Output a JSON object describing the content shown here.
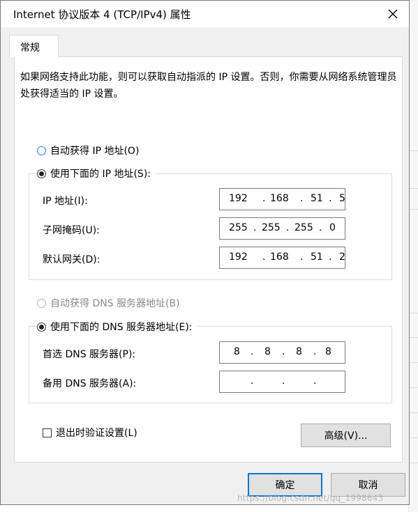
{
  "window": {
    "title": "Internet 协议版本 4 (TCP/IPv4) 属性"
  },
  "tabs": [
    {
      "label": "常规"
    }
  ],
  "description": "如果网络支持此功能，则可以获取自动指派的 IP 设置。否则，你需要从网络系统管理员处获得适当的 IP 设置。",
  "ip_options": {
    "auto": "自动获得 IP 地址(O)",
    "manual": "使用下面的 IP 地址(S):"
  },
  "ip_fields": {
    "address": {
      "label": "IP 地址(I):",
      "octets": [
        "192",
        "168",
        "51",
        "5"
      ]
    },
    "subnet": {
      "label": "子网掩码(U):",
      "octets": [
        "255",
        "255",
        "255",
        "0"
      ]
    },
    "gateway": {
      "label": "默认网关(D):",
      "octets": [
        "192",
        "168",
        "51",
        "2"
      ]
    }
  },
  "dns_options": {
    "auto": "自动获得 DNS 服务器地址(B)",
    "manual": "使用下面的 DNS 服务器地址(E):"
  },
  "dns_fields": {
    "preferred": {
      "label": "首选 DNS 服务器(P):",
      "octets": [
        "8",
        "8",
        "8",
        "8"
      ]
    },
    "alternate": {
      "label": "备用 DNS 服务器(A):",
      "octets": [
        "",
        "",
        "",
        ""
      ]
    }
  },
  "validate_on_exit": {
    "label": "退出时验证设置(L)",
    "checked": false
  },
  "buttons": {
    "advanced": "高级(V)...",
    "ok": "确定",
    "cancel": "取消"
  },
  "watermark": "https://blog.csdn.net/qq_1998643",
  "colors": {
    "accent": "#0078d7",
    "radio_unselected_blue": "#1f7fd6"
  }
}
